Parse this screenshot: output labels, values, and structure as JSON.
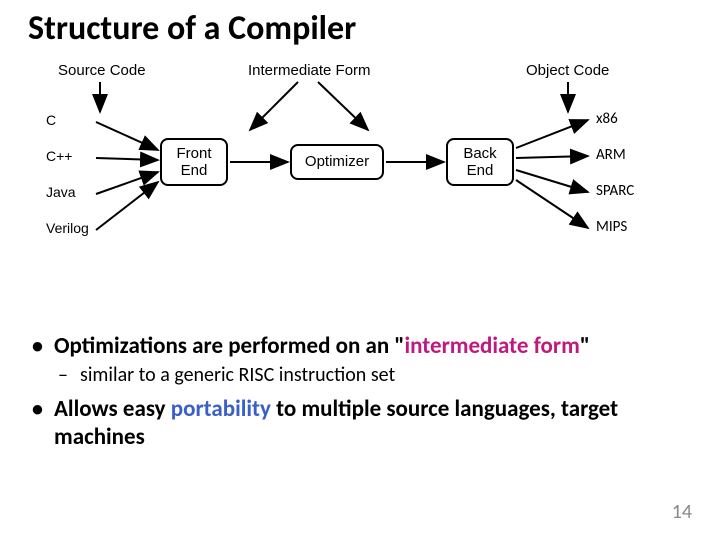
{
  "title": "Structure of a Compiler",
  "top_labels": {
    "source": "Source Code",
    "intermediate": "Intermediate Form",
    "object": "Object Code"
  },
  "inputs": [
    "C",
    "C++",
    "Java",
    "Verilog"
  ],
  "stages": {
    "front": "Front\nEnd",
    "opt": "Optimizer",
    "back": "Back\nEnd"
  },
  "outputs": [
    "x86",
    "ARM",
    "SPARC",
    "MIPS"
  ],
  "bullets": {
    "b1_pre": "Optimizations are performed on an \"",
    "b1_hl": "intermediate form",
    "b1_post": "\"",
    "sub1": "similar to a generic RISC instruction set",
    "b2_pre": "Allows easy ",
    "b2_hl": "portability",
    "b2_post": " to multiple source languages, target machines"
  },
  "slide_number": "14"
}
